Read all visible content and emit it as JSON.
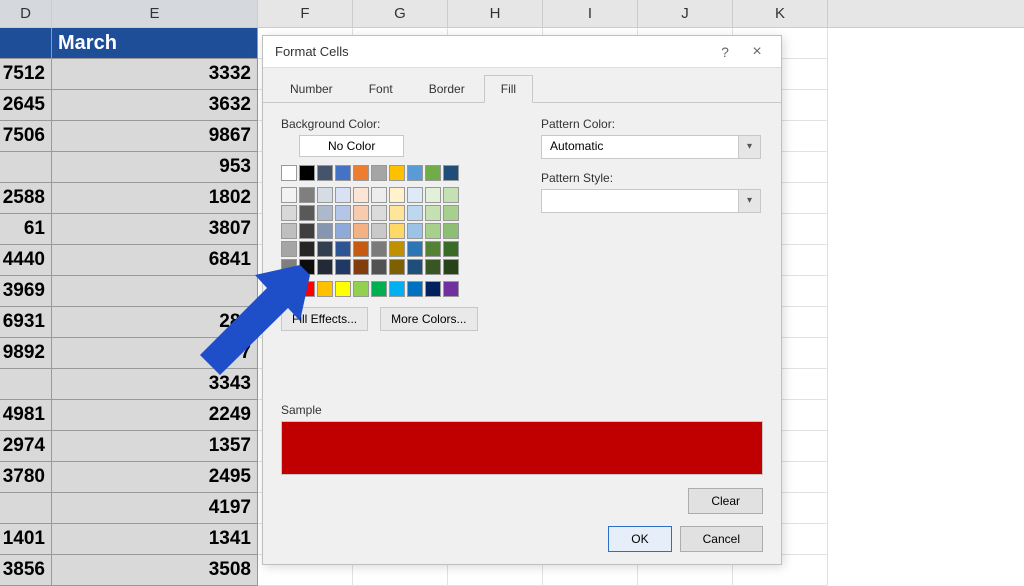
{
  "columns": [
    "D",
    "E",
    "F",
    "G",
    "H",
    "I",
    "J",
    "K"
  ],
  "header_label": "March",
  "data_rows": [
    [
      "7512",
      "3332"
    ],
    [
      "2645",
      "3632"
    ],
    [
      "7506",
      "9867"
    ],
    [
      "",
      "953"
    ],
    [
      "2588",
      "1802"
    ],
    [
      "61",
      "3807"
    ],
    [
      "4440",
      "6841"
    ],
    [
      "3969",
      ""
    ],
    [
      "6931",
      "282"
    ],
    [
      "9892",
      "7"
    ],
    [
      "",
      "3343"
    ],
    [
      "4981",
      "2249"
    ],
    [
      "2974",
      "1357"
    ],
    [
      "3780",
      "2495"
    ],
    [
      "",
      "4197"
    ],
    [
      "1401",
      "1341"
    ],
    [
      "3856",
      "3508"
    ]
  ],
  "dialog": {
    "title": "Format Cells",
    "help": "?",
    "close": "×",
    "tabs": [
      "Number",
      "Font",
      "Border",
      "Fill"
    ],
    "active_tab": 3,
    "bg_label": "Background Color:",
    "no_color": "No Color",
    "fill_effects": "Fill Effects...",
    "more_colors": "More Colors...",
    "pattern_color_label": "Pattern Color:",
    "pattern_color_value": "Automatic",
    "pattern_style_label": "Pattern Style:",
    "pattern_style_value": "",
    "sample_label": "Sample",
    "sample_color": "#c00000",
    "clear": "Clear",
    "ok": "OK",
    "cancel": "Cancel",
    "theme_colors_row1": [
      "#ffffff",
      "#000000",
      "#44546a",
      "#4472c4",
      "#ed7d31",
      "#a5a5a5",
      "#ffc000",
      "#5b9bd5",
      "#70ad47",
      "#1f4e79"
    ],
    "theme_tints": [
      [
        "#f2f2f2",
        "#7f7f7f",
        "#d5dce4",
        "#d9e2f3",
        "#fbe5d5",
        "#ededed",
        "#fff2cc",
        "#deebf6",
        "#e2efd9",
        "#c5e0b3"
      ],
      [
        "#d8d8d8",
        "#595959",
        "#adb9ca",
        "#b4c6e7",
        "#f7cbac",
        "#dbdbdb",
        "#fee599",
        "#bdd7ee",
        "#c5e0b3",
        "#a8d08d"
      ],
      [
        "#bfbfbf",
        "#3f3f3f",
        "#8496b0",
        "#8eaadb",
        "#f4b183",
        "#c9c9c9",
        "#ffd965",
        "#9cc3e5",
        "#a8d08d",
        "#8cbf73"
      ],
      [
        "#a5a5a5",
        "#262626",
        "#323f4f",
        "#2f5496",
        "#c55a11",
        "#7b7b7b",
        "#bf9000",
        "#2e75b5",
        "#538135",
        "#3a6b26"
      ],
      [
        "#7f7f7f",
        "#0c0c0c",
        "#222a35",
        "#1f3864",
        "#833c0b",
        "#525252",
        "#7f6000",
        "#1e4e79",
        "#375623",
        "#274418"
      ]
    ],
    "standard_colors": [
      "#c00000",
      "#ff0000",
      "#ffc000",
      "#ffff00",
      "#92d050",
      "#00b050",
      "#00b0f0",
      "#0070c0",
      "#002060",
      "#7030a0"
    ]
  }
}
